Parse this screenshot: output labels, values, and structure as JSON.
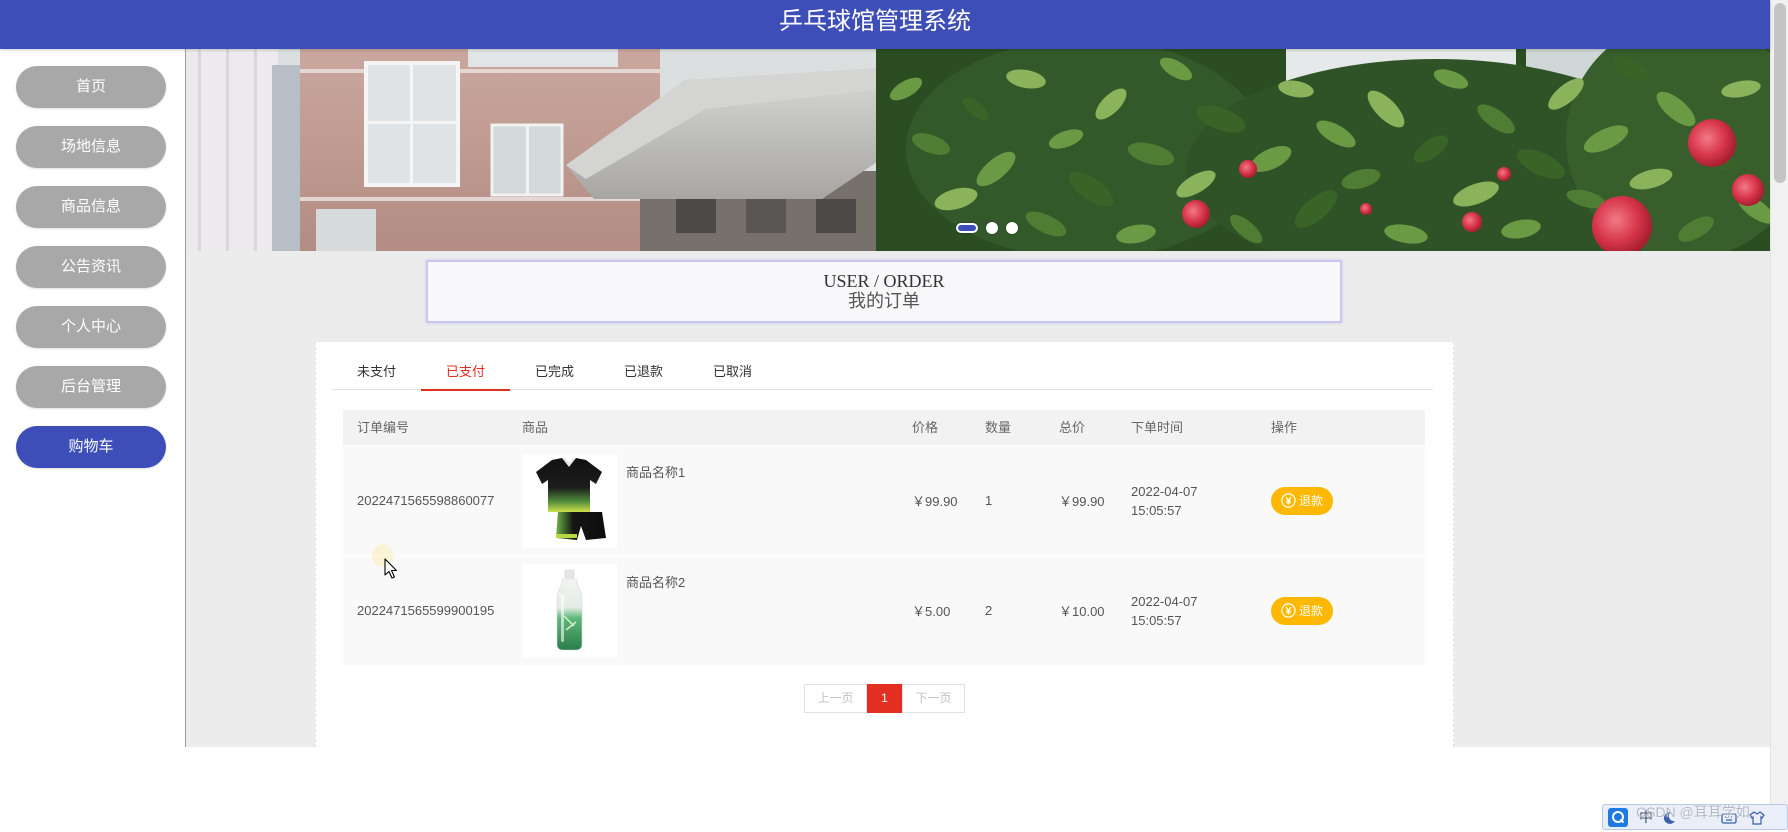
{
  "header": {
    "title": "乒乓球馆管理系统"
  },
  "colors": {
    "primary": "#3d4eb8",
    "nav_inactive": "#a8a8a8",
    "accent_red": "#e22f22",
    "refund_button": "#ffb800",
    "page_bg": "#ececec"
  },
  "sidebar": {
    "items": [
      {
        "label": "首页",
        "active": false
      },
      {
        "label": "场地信息",
        "active": false
      },
      {
        "label": "商品信息",
        "active": false
      },
      {
        "label": "公告资讯",
        "active": false
      },
      {
        "label": "个人中心",
        "active": false
      },
      {
        "label": "后台管理",
        "active": false
      },
      {
        "label": "购物车",
        "active": true
      }
    ]
  },
  "banner": {
    "dots": [
      {
        "active": true
      },
      {
        "active": false
      },
      {
        "active": false
      }
    ]
  },
  "section_title": {
    "en": "USER / ORDER",
    "zh": "我的订单"
  },
  "tabs": [
    {
      "label": "未支付",
      "active": false
    },
    {
      "label": "已支付",
      "active": true
    },
    {
      "label": "已完成",
      "active": false
    },
    {
      "label": "已退款",
      "active": false
    },
    {
      "label": "已取消",
      "active": false
    }
  ],
  "table": {
    "columns": [
      "订单编号",
      "商品",
      "价格",
      "数量",
      "总价",
      "下单时间",
      "操作"
    ],
    "rows": [
      {
        "order_no": "2022471565598860077",
        "image": "sportswear-set-image",
        "product_name": "商品名称1",
        "price": "￥99.90",
        "quantity": "1",
        "total": "￥99.90",
        "order_time": "2022-04-07 15:05:57",
        "action_label": "退款",
        "action_icon": "yen-circle-icon"
      },
      {
        "order_no": "2022471565599900195",
        "image": "water-bottle-image",
        "product_name": "商品名称2",
        "price": "￥5.00",
        "quantity": "2",
        "total": "￥10.00",
        "order_time": "2022-04-07 15:05:57",
        "action_label": "退款",
        "action_icon": "yen-circle-icon"
      }
    ]
  },
  "pagination": {
    "prev": "上一页",
    "current": "1",
    "next": "下一页"
  },
  "ime": {
    "mode": "中"
  },
  "watermark": "CSDN @耳耳学如"
}
